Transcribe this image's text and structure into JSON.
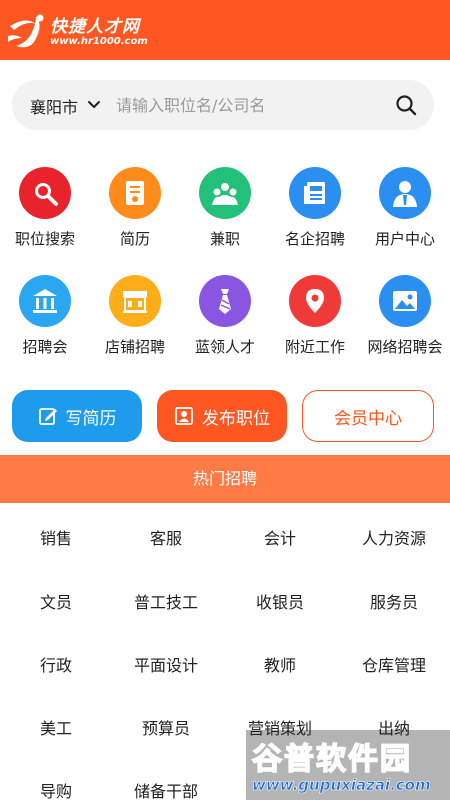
{
  "header": {
    "logo_title": "快捷人才网",
    "logo_url": "www.hr1000.com",
    "brand_color": "#ff5722"
  },
  "search": {
    "city": "襄阳市",
    "placeholder": "请输入职位名/公司名"
  },
  "grid": {
    "items": [
      {
        "label": "职位搜索",
        "icon": "magnifier-icon",
        "color": "#e8232b"
      },
      {
        "label": "简历",
        "icon": "document-icon",
        "color": "#ff8c1a"
      },
      {
        "label": "兼职",
        "icon": "group-icon",
        "color": "#23c07a"
      },
      {
        "label": "名企招聘",
        "icon": "newspaper-icon",
        "color": "#2a8ff0"
      },
      {
        "label": "用户中心",
        "icon": "user-icon",
        "color": "#2a8ff0"
      },
      {
        "label": "招聘会",
        "icon": "building-icon",
        "color": "#2aa7f0"
      },
      {
        "label": "店铺招聘",
        "icon": "storefront-icon",
        "color": "#ffae1a"
      },
      {
        "label": "蓝领人才",
        "icon": "tie-icon",
        "color": "#8a55e0"
      },
      {
        "label": "附近工作",
        "icon": "location-pin-icon",
        "color": "#f03a3a"
      },
      {
        "label": "网络招聘会",
        "icon": "image-icon",
        "color": "#2a8ff0"
      }
    ]
  },
  "buttons": {
    "resume": "写简历",
    "post": "发布职位",
    "member": "会员中心"
  },
  "hot": {
    "title": "热门招聘",
    "jobs": [
      "销售",
      "客服",
      "会计",
      "人力资源",
      "文员",
      "普工技工",
      "收银员",
      "服务员",
      "行政",
      "平面设计",
      "教师",
      "仓库管理",
      "美工",
      "预算员",
      "营销策划",
      "出纳",
      "导购",
      "储备干部",
      "",
      ""
    ]
  },
  "watermark": {
    "title": "谷普软件园",
    "url": "www.gupuxiazai.com"
  }
}
